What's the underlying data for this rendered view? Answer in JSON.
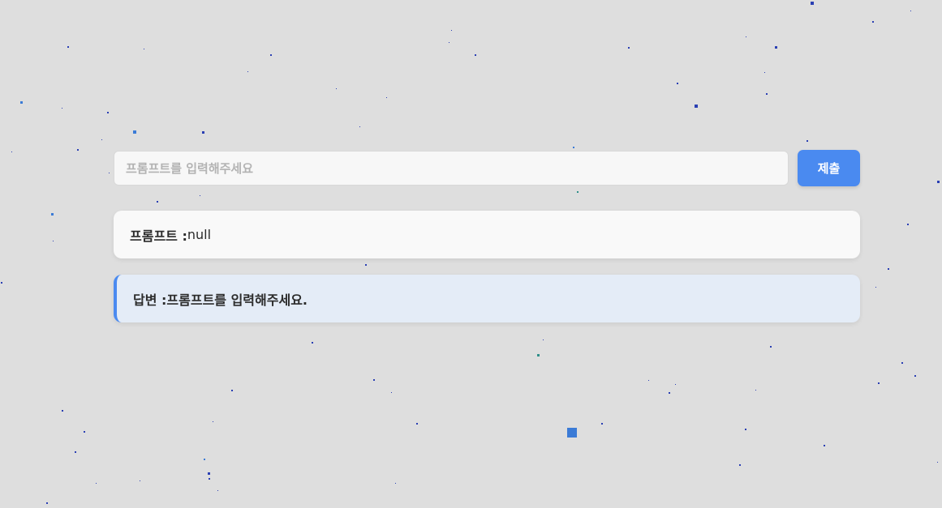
{
  "prompt_form": {
    "input_placeholder": "프롬프트를 입력해주세요",
    "input_value": "",
    "submit_label": "제출"
  },
  "prompt_card": {
    "label": "프롬프트 : ",
    "value": "null"
  },
  "answer_card": {
    "label": "답변 : ",
    "value": "프롬프트를 입력해주세요."
  },
  "colors": {
    "background": "#dedede",
    "accent": "#4a8af0",
    "answer_background": "#e4ecf7",
    "star": "#2a3fb3"
  }
}
